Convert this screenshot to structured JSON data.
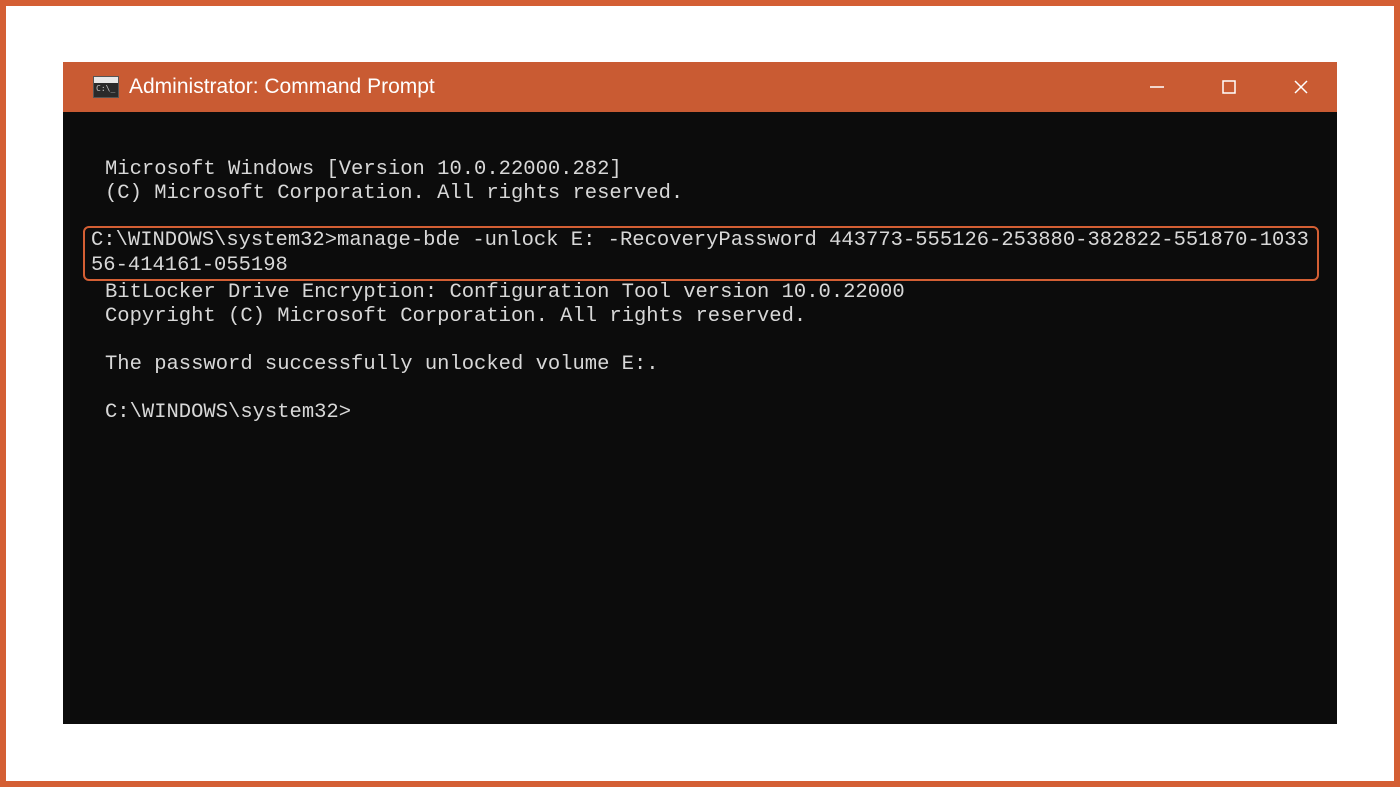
{
  "window": {
    "title": "Administrator: Command Prompt"
  },
  "terminal": {
    "line1": "Microsoft Windows [Version 10.0.22000.282]",
    "line2": "(C) Microsoft Corporation. All rights reserved.",
    "highlighted_command": "C:\\WINDOWS\\system32>manage-bde -unlock E: -RecoveryPassword 443773-555126-253880-382822-551870-103356-414161-055198",
    "line4": "BitLocker Drive Encryption: Configuration Tool version 10.0.22000",
    "line5": "Copyright (C) Microsoft Corporation. All rights reserved.",
    "line6": "The password successfully unlocked volume E:.",
    "prompt": "C:\\WINDOWS\\system32>"
  },
  "colors": {
    "accent": "#d45f34",
    "titlebar": "#c95b33",
    "terminal_bg": "#0c0c0c",
    "terminal_fg": "#d8d8d8"
  }
}
